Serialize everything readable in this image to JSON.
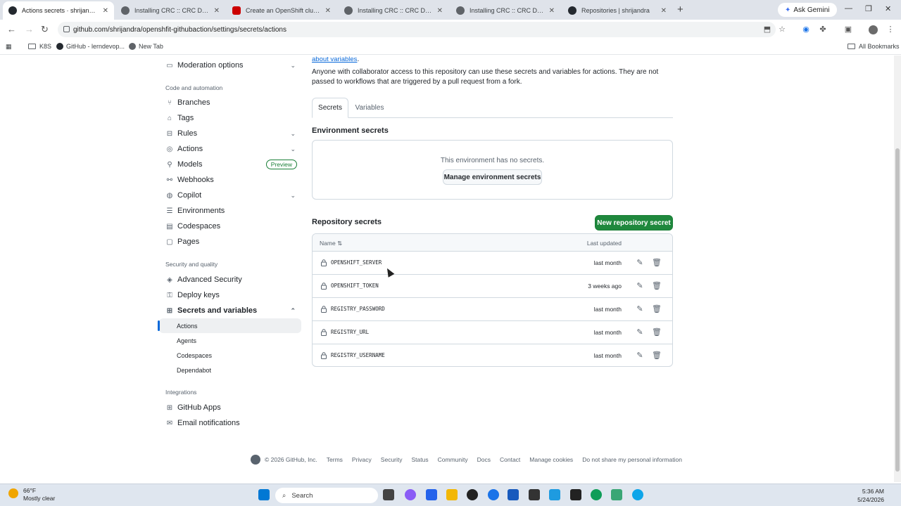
{
  "browser": {
    "tabs": [
      {
        "title": "Actions secrets · shrijandra/ope",
        "active": true
      },
      {
        "title": "Installing CRC :: CRC Document"
      },
      {
        "title": "Create an OpenShift cluster | Re"
      },
      {
        "title": "Installing CRC :: CRC Document"
      },
      {
        "title": "Installing CRC :: CRC Document"
      },
      {
        "title": "Repositories | shrijandra"
      }
    ],
    "new_tab": "+",
    "ask_gemini": "Ask Gemini",
    "url": "github.com/shrijandra/openshfit-githubaction/settings/secrets/actions",
    "bookmarks": [
      "K8S",
      "GitHub - lerndevop...",
      "New Tab"
    ],
    "all_bookmarks": "All Bookmarks"
  },
  "sidebar": {
    "moderation": "Moderation options",
    "code_automation_heading": "Code and automation",
    "code_items": [
      {
        "label": "Branches",
        "icon": "branch-icon"
      },
      {
        "label": "Tags",
        "icon": "tag-icon"
      },
      {
        "label": "Rules",
        "icon": "rules-icon",
        "chevron": true
      },
      {
        "label": "Actions",
        "icon": "play-icon",
        "chevron": true
      },
      {
        "label": "Models",
        "icon": "models-icon",
        "badge": "Preview"
      },
      {
        "label": "Webhooks",
        "icon": "webhook-icon"
      },
      {
        "label": "Copilot",
        "icon": "copilot-icon",
        "chevron": true
      },
      {
        "label": "Environments",
        "icon": "server-icon"
      },
      {
        "label": "Codespaces",
        "icon": "codespaces-icon"
      },
      {
        "label": "Pages",
        "icon": "browser-icon"
      }
    ],
    "security_heading": "Security and quality",
    "security_items": [
      {
        "label": "Advanced Security",
        "icon": "shield-icon"
      },
      {
        "label": "Deploy keys",
        "icon": "key-icon"
      },
      {
        "label": "Secrets and variables",
        "icon": "asterisk-icon",
        "expanded": true
      }
    ],
    "secrets_sub": [
      "Actions",
      "Agents",
      "Codespaces",
      "Dependabot"
    ],
    "integrations_heading": "Integrations",
    "integration_items": [
      {
        "label": "GitHub Apps",
        "icon": "apps-icon"
      },
      {
        "label": "Email notifications",
        "icon": "mail-icon"
      }
    ]
  },
  "main": {
    "about_link": "about variables",
    "about_suffix": ".",
    "description": "Anyone with collaborator access to this repository can use these secrets and variables for actions. They are not passed to workflows that are triggered by a pull request from a fork.",
    "tabs": [
      "Secrets",
      "Variables"
    ],
    "env_heading": "Environment secrets",
    "env_empty": "This environment has no secrets.",
    "env_button": "Manage environment secrets",
    "repo_heading": "Repository secrets",
    "new_secret_button": "New repository secret",
    "table_header": {
      "name": "Name",
      "updated": "Last updated"
    },
    "secrets": [
      {
        "name": "OPENSHIFT_SERVER",
        "updated": "last month"
      },
      {
        "name": "OPENSHIFT_TOKEN",
        "updated": "3 weeks ago"
      },
      {
        "name": "REGISTRY_PASSWORD",
        "updated": "last month"
      },
      {
        "name": "REGISTRY_URL",
        "updated": "last month"
      },
      {
        "name": "REGISTRY_USERNAME",
        "updated": "last month"
      }
    ]
  },
  "footer": {
    "copyright": "© 2026 GitHub, Inc.",
    "links": [
      "Terms",
      "Privacy",
      "Security",
      "Status",
      "Community",
      "Docs",
      "Contact",
      "Manage cookies",
      "Do not share my personal information"
    ]
  },
  "taskbar": {
    "weather_temp": "66°F",
    "weather_desc": "Mostly clear",
    "search_placeholder": "Search",
    "time": "5:36 AM",
    "date": "5/24/2026"
  },
  "colors": {
    "accent": "#0969da",
    "green": "#1f883d",
    "border": "#d1d9e0"
  }
}
